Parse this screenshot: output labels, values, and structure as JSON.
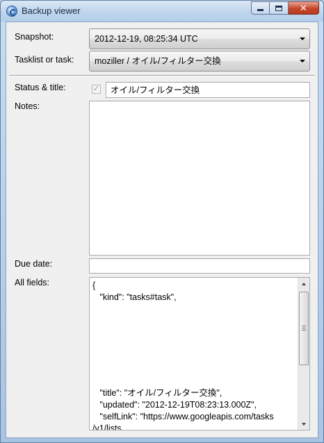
{
  "window": {
    "title": "Backup viewer",
    "icon": "backup-app-icon"
  },
  "form": {
    "snapshot_label": "Snapshot:",
    "snapshot_value": "2012-12-19, 08:25:34 UTC",
    "task_label": "Tasklist or task:",
    "task_value": "moziller / オイル/フィルター交換",
    "status_label": "Status & title:",
    "status_checked": true,
    "title_value": "オイル/フィルター交換",
    "notes_label": "Notes:",
    "notes_value": "",
    "due_label": "Due date:",
    "due_value": "",
    "fields_label": "All fields:"
  },
  "all_fields": {
    "text": "{\n   \"kind\": \"tasks#task\",\n\n\n\n\n\n\n\n   \"title\": \"オイル/フィルター交換\",\n   \"updated\": \"2012-12-19T08:23:13.000Z\",\n   \"selfLink\": \"https://www.googleapis.com/tasks\n/v1/lists"
  },
  "colors": {
    "title_bar": "#c1d6ee",
    "close_button": "#c6452a",
    "client_bg": "#f0f0f0"
  }
}
